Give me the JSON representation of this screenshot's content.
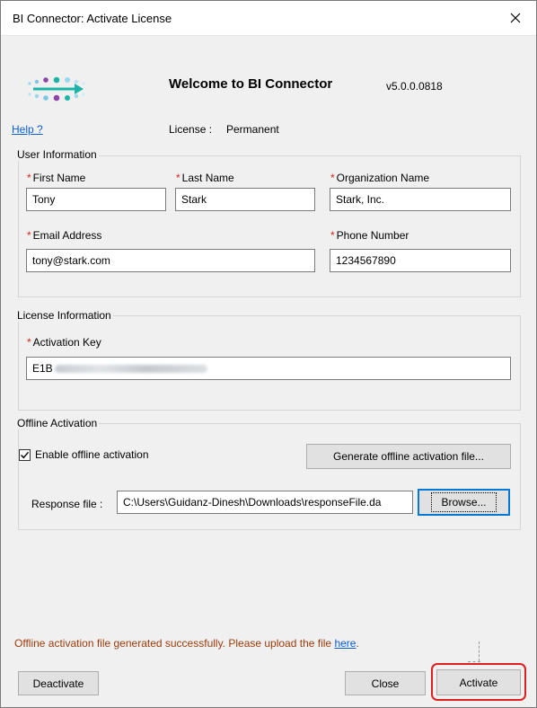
{
  "window": {
    "title": "BI Connector: Activate License"
  },
  "header": {
    "welcome": "Welcome to BI Connector",
    "version": "v5.0.0.0818",
    "help_link": "Help ?",
    "license_label": "License :",
    "license_value": "Permanent"
  },
  "user_info": {
    "title": "User Information",
    "required_mark": "*",
    "first_name": {
      "label": "First Name",
      "value": "Tony"
    },
    "last_name": {
      "label": "Last Name",
      "value": "Stark"
    },
    "organization": {
      "label": "Organization Name",
      "value": "Stark, Inc."
    },
    "email": {
      "label": "Email Address",
      "value": "tony@stark.com"
    },
    "phone": {
      "label": "Phone Number",
      "value": "1234567890"
    }
  },
  "license_info": {
    "title": "License Information",
    "activation_key": {
      "label": "Activation Key",
      "value_visible": "E1B"
    }
  },
  "offline": {
    "title": "Offline Activation",
    "enable_label": "Enable offline activation",
    "enable_checked": true,
    "generate_button": "Generate offline activation file...",
    "response_label": "Response file :",
    "response_value": "C:\\Users\\Guidanz-Dinesh\\Downloads\\responseFile.da",
    "browse_button": "Browse..."
  },
  "status": {
    "message": "Offline activation file generated successfully. Please upload the file",
    "link": "here",
    "suffix": ".",
    "color": "#9b3b0b"
  },
  "footer": {
    "deactivate": "Deactivate",
    "close": "Close",
    "activate": "Activate"
  },
  "colors": {
    "accent": "#0078d7",
    "required": "#d9251c",
    "highlight": "#e02020",
    "logo_teal": "#1bb5a7",
    "logo_purple": "#8e44ad"
  },
  "icons": {
    "logo": "bi-connector-logo",
    "close": "close-icon",
    "check": "checkmark-icon"
  }
}
